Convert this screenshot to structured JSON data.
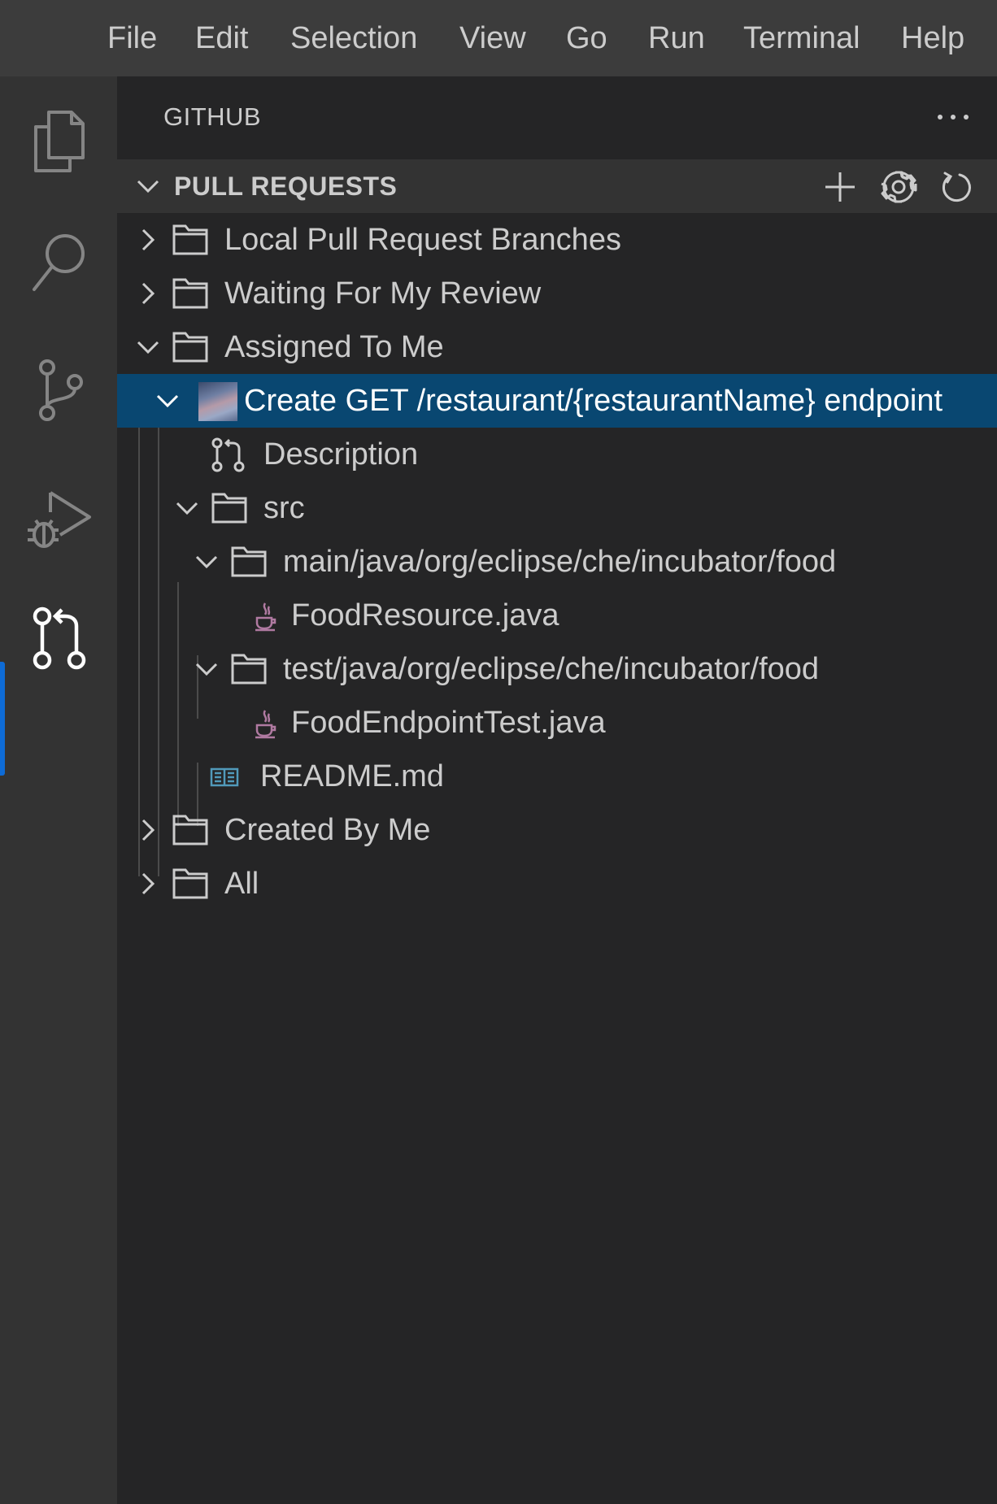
{
  "menubar": {
    "items": [
      "File",
      "Edit",
      "Selection",
      "View",
      "Go",
      "Run",
      "Terminal",
      "Help"
    ]
  },
  "activity_bar": {
    "icons": [
      "files-icon",
      "search-icon",
      "source-control-icon",
      "run-debug-icon",
      "pull-request-icon"
    ],
    "active": "pull-request-icon"
  },
  "sidebar": {
    "title": "GITHUB",
    "section": {
      "title": "PULL REQUESTS",
      "actions": [
        "add-icon",
        "settings-gear-icon",
        "refresh-icon"
      ]
    },
    "tree": {
      "local_branches": "Local Pull Request Branches",
      "waiting_review": "Waiting For My Review",
      "assigned": "Assigned To Me",
      "pr_title": "Create GET /restaurant/{restaurantName} endpoint",
      "description": "Description",
      "src": "src",
      "main_folder": "main/java/org/eclipse/che/incubator/food",
      "main_file": "FoodResource.java",
      "test_folder": "test/java/org/eclipse/che/incubator/food",
      "test_file": "FoodEndpointTest.java",
      "readme": "README.md",
      "created_by_me": "Created By Me",
      "all": "All"
    }
  },
  "colors": {
    "menubar_bg": "#3c3c3c",
    "activity_bg": "#333333",
    "sidebar_bg": "#252526",
    "selection_bg": "#094771",
    "active_indicator": "#0e6bd6",
    "java_icon": "#b07aa1",
    "readme_icon": "#519aba"
  }
}
